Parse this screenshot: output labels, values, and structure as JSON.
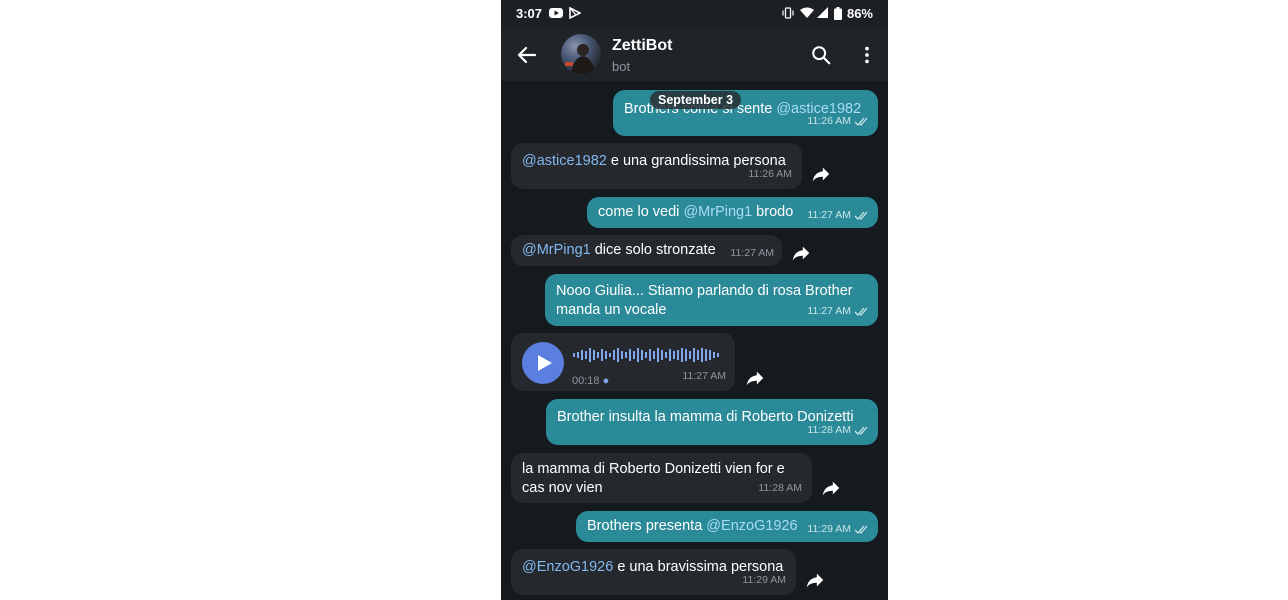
{
  "status": {
    "time": "3:07",
    "battery": "86%"
  },
  "header": {
    "title": "ZettiBot",
    "subtitle": "bot"
  },
  "date_label": "September 3",
  "messages": [
    {
      "dir": "out",
      "text": "Brothers come si sente ",
      "mention": "@astice1982",
      "time": "11:26 AM"
    },
    {
      "dir": "in",
      "mention": "@astice1982",
      "text": " e una grandissima persona",
      "time": "11:26 AM"
    },
    {
      "dir": "out",
      "text": "come lo vedi ",
      "mention": "@MrPing1",
      "text2": " brodo",
      "time": "11:27 AM"
    },
    {
      "dir": "in",
      "mention": "@MrPing1",
      "text": " dice solo stronzate",
      "time": "11:27 AM"
    },
    {
      "dir": "out",
      "line1": "Nooo Giulia... Stiamo parlando di rosa Brother",
      "line2": "manda un vocale",
      "time": "11:27 AM"
    },
    {
      "dir": "in",
      "type": "voice",
      "duration": "00:18",
      "time": "11:27 AM"
    },
    {
      "dir": "out",
      "text": "Brother insulta la mamma di Roberto Donizetti",
      "time": "11:28 AM"
    },
    {
      "dir": "in",
      "line1": "la mamma di Roberto Donizetti vien for e",
      "line2": "cas nov vien",
      "time": "11:28 AM"
    },
    {
      "dir": "out",
      "text": "Brothers presenta ",
      "mention": "@EnzoG1926",
      "time": "11:29 AM"
    },
    {
      "dir": "in",
      "mention": "@EnzoG1926",
      "text": " e una bravissima persona",
      "time": "11:29 AM"
    }
  ],
  "colors": {
    "outgoing": "#2b8a98",
    "incoming": "#25292d",
    "background": "#151a1f",
    "accent": "#5b7fe0"
  }
}
